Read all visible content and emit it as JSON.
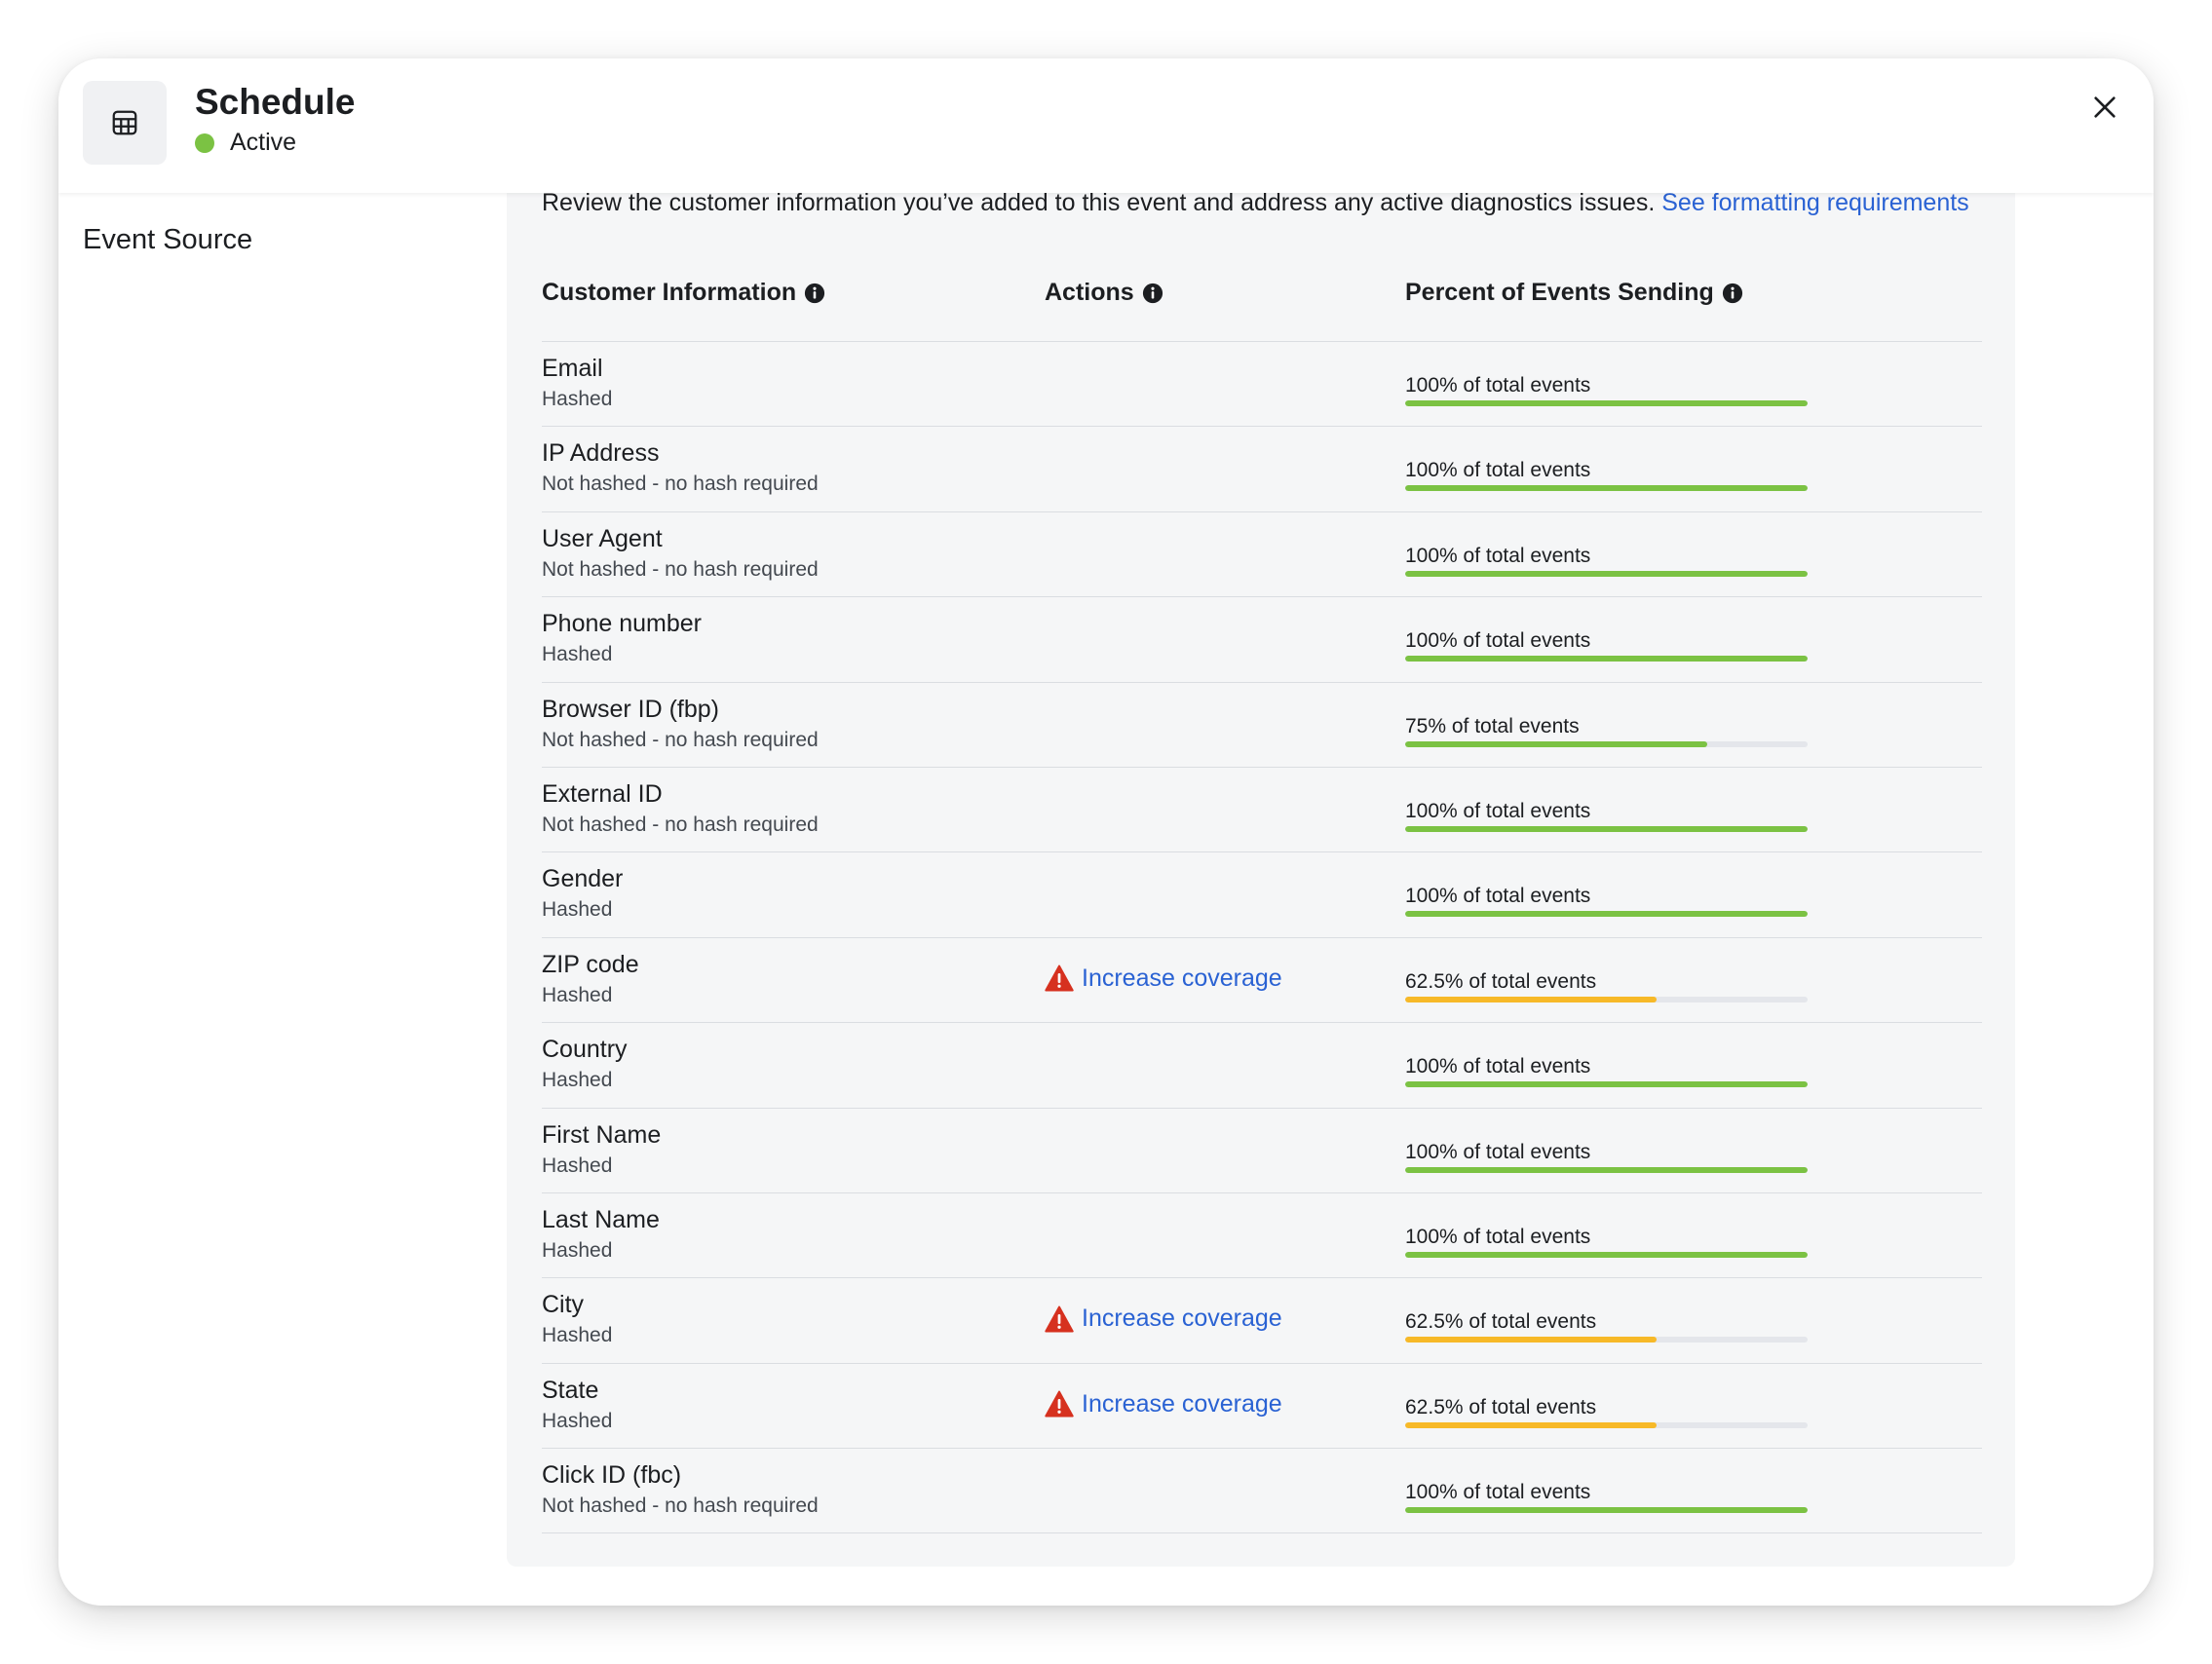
{
  "header": {
    "title": "Schedule",
    "status": "Active",
    "status_color": "#7bc243",
    "app_icon": "table-icon",
    "close_icon": "close-icon"
  },
  "sidebar": {
    "items": [
      {
        "label": "Event Source"
      }
    ]
  },
  "main": {
    "intro_text": "Review the customer information you’ve added to this event and address any active diagnostics issues.",
    "intro_link": "See formatting requirements",
    "columns": [
      {
        "label": "Customer Information",
        "icon": "info-icon"
      },
      {
        "label": "Actions",
        "icon": "info-icon"
      },
      {
        "label": "Percent of Events Sending",
        "icon": "info-icon"
      }
    ],
    "colors": {
      "good": "#7bc243",
      "warning": "#f7b928",
      "link": "#2a62d3",
      "alert": "#d6311f"
    },
    "rows": [
      {
        "name": "Email",
        "sub": "Hashed",
        "action": "",
        "percent_label": "100% of total events",
        "percent": 100
      },
      {
        "name": "IP Address",
        "sub": "Not hashed - no hash required",
        "action": "",
        "percent_label": "100% of total events",
        "percent": 100
      },
      {
        "name": "User Agent",
        "sub": "Not hashed - no hash required",
        "action": "",
        "percent_label": "100% of total events",
        "percent": 100
      },
      {
        "name": "Phone number",
        "sub": "Hashed",
        "action": "",
        "percent_label": "100% of total events",
        "percent": 100
      },
      {
        "name": "Browser ID (fbp)",
        "sub": "Not hashed - no hash required",
        "action": "",
        "percent_label": "75% of total events",
        "percent": 75
      },
      {
        "name": "External ID",
        "sub": "Not hashed - no hash required",
        "action": "",
        "percent_label": "100% of total events",
        "percent": 100
      },
      {
        "name": "Gender",
        "sub": "Hashed",
        "action": "",
        "percent_label": "100% of total events",
        "percent": 100
      },
      {
        "name": "ZIP code",
        "sub": "Hashed",
        "action": "Increase coverage",
        "percent_label": "62.5% of total events",
        "percent": 62.5
      },
      {
        "name": "Country",
        "sub": "Hashed",
        "action": "",
        "percent_label": "100% of total events",
        "percent": 100
      },
      {
        "name": "First Name",
        "sub": "Hashed",
        "action": "",
        "percent_label": "100% of total events",
        "percent": 100
      },
      {
        "name": "Last Name",
        "sub": "Hashed",
        "action": "",
        "percent_label": "100% of total events",
        "percent": 100
      },
      {
        "name": "City",
        "sub": "Hashed",
        "action": "Increase coverage",
        "percent_label": "62.5% of total events",
        "percent": 62.5
      },
      {
        "name": "State",
        "sub": "Hashed",
        "action": "Increase coverage",
        "percent_label": "62.5% of total events",
        "percent": 62.5
      },
      {
        "name": "Click ID (fbc)",
        "sub": "Not hashed - no hash required",
        "action": "",
        "percent_label": "100% of total events",
        "percent": 100
      }
    ]
  }
}
